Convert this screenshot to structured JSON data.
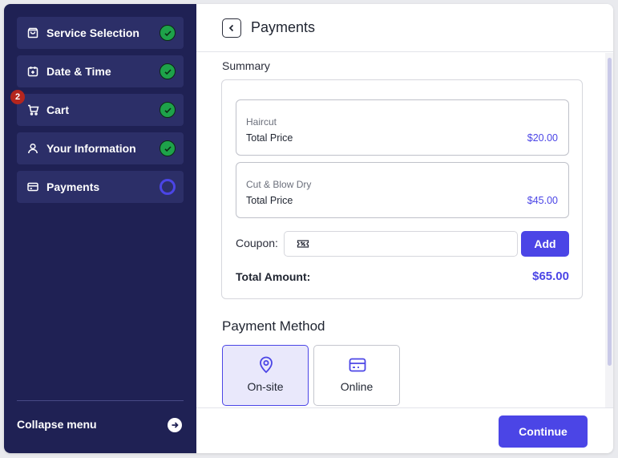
{
  "sidebar": {
    "steps": [
      {
        "label": "Service Selection",
        "icon": "shopping-bag-icon",
        "status": "done"
      },
      {
        "label": "Date & Time",
        "icon": "calendar-icon",
        "status": "done"
      },
      {
        "label": "Cart",
        "icon": "cart-icon",
        "status": "done",
        "badge": "2"
      },
      {
        "label": "Your Information",
        "icon": "user-icon",
        "status": "done"
      },
      {
        "label": "Payments",
        "icon": "credit-card-icon",
        "status": "current"
      }
    ],
    "collapse_label": "Collapse menu"
  },
  "header": {
    "title": "Payments"
  },
  "summary": {
    "label": "Summary",
    "items": [
      {
        "name": "Haircut",
        "price_label": "Total Price",
        "price": "$20.00"
      },
      {
        "name": "Cut & Blow Dry",
        "price_label": "Total Price",
        "price": "$45.00"
      }
    ],
    "coupon_label": "Coupon:",
    "coupon_value": "",
    "add_label": "Add",
    "total_label": "Total Amount:",
    "total_value": "$65.00"
  },
  "payment_method": {
    "title": "Payment Method",
    "options": [
      {
        "label": "On-site",
        "icon": "location-pin-icon",
        "selected": true
      },
      {
        "label": "Online",
        "icon": "credit-card-icon",
        "selected": false
      }
    ]
  },
  "footer": {
    "continue_label": "Continue"
  },
  "colors": {
    "sidebar_bg": "#1f2154",
    "step_bg": "#2c2f68",
    "accent": "#4b45e6",
    "done_green": "#1ea24a",
    "badge_red": "#b5261e"
  }
}
